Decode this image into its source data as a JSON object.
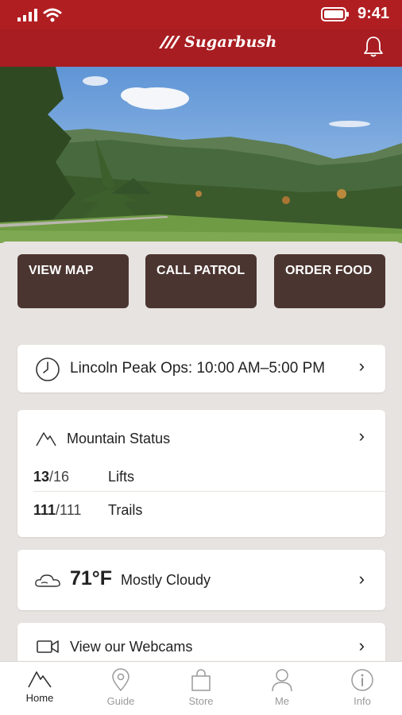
{
  "status_bar": {
    "time": "9:41",
    "icons": [
      "cellular-signal-icon",
      "wifi-icon",
      "battery-icon"
    ]
  },
  "header": {
    "logo_text": "Sugarbush",
    "icons": [
      "sugarbush-logo-icon",
      "bell-icon"
    ]
  },
  "quick_actions": {
    "view_map": "VIEW MAP",
    "call_patrol": "CALL PATROL",
    "order_food": "ORDER FOOD"
  },
  "ops": {
    "label": "Lincoln Peak Ops: 10:00 AM–5:00 PM",
    "icon": "clock-icon"
  },
  "mountain_status": {
    "title": "Mountain Status",
    "icon": "mountain-icon",
    "lifts": {
      "open": "13",
      "total": "/16",
      "label": "Lifts"
    },
    "trails": {
      "open": "111",
      "total": "/111",
      "label": "Trails"
    }
  },
  "weather": {
    "temp": "71°F",
    "condition": "Mostly Cloudy",
    "icon": "cloud-icon"
  },
  "webcams": {
    "label": "View our Webcams",
    "icon": "video-camera-icon"
  },
  "nav": {
    "home": "Home",
    "guide": "Guide",
    "store": "Store",
    "me": "Me",
    "info": "Info"
  },
  "colors": {
    "brand_red": "#a81d21",
    "status_red": "#b11e22",
    "quick_action_brown": "#4b3530",
    "panel_bg": "#e7e3e0"
  }
}
